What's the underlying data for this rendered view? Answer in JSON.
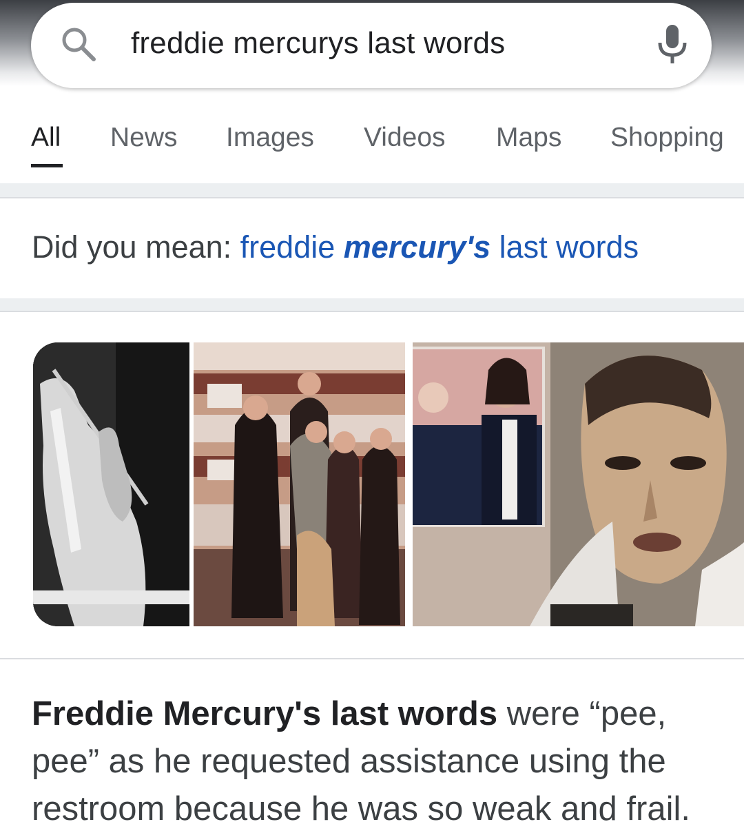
{
  "search": {
    "query": "freddie mercurys last words"
  },
  "tabs": [
    {
      "label": "All",
      "active": true
    },
    {
      "label": "News",
      "active": false
    },
    {
      "label": "Images",
      "active": false
    },
    {
      "label": "Videos",
      "active": false
    },
    {
      "label": "Maps",
      "active": false
    },
    {
      "label": "Shopping",
      "active": false
    }
  ],
  "did_you_mean": {
    "prefix": "Did you mean: ",
    "part1": "freddie ",
    "emphasis": "mercury's",
    "part2": " last words"
  },
  "images": [
    {
      "name": "freddie-bw-stage-photo"
    },
    {
      "name": "queen-band-group-photo"
    },
    {
      "name": "band-members-tuxedo-photo"
    },
    {
      "name": "freddie-closeup-photo"
    }
  ],
  "answer": {
    "bold": "Freddie Mercury's last words",
    "text": " were “pee, pee” as he requested assistance using the restroom because he was so weak and frail."
  },
  "colors": {
    "link": "#1a56b4",
    "text": "#3c4043",
    "active_tab": "#202124"
  }
}
